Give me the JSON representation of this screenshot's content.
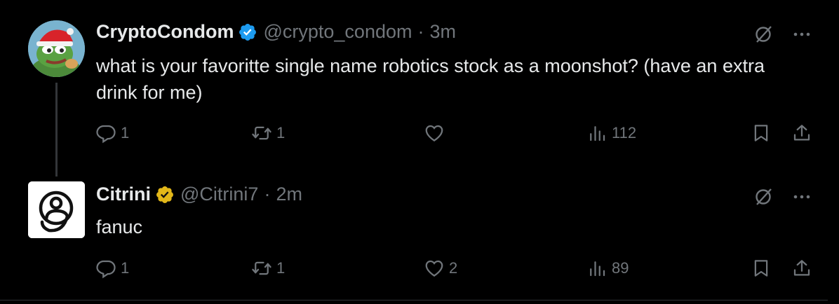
{
  "tweets": [
    {
      "display_name": "CryptoCondom",
      "handle": "@crypto_condom",
      "separator": "·",
      "time": "3m",
      "text": "what is your favoritte single name robotics stock as a moonshot? (have an extra drink for me)",
      "badge_color": "#1d9bf0",
      "replies": "1",
      "retweets": "1",
      "likes": "",
      "views": "112"
    },
    {
      "display_name": "Citrini",
      "handle": "@Citrini7",
      "separator": "·",
      "time": "2m",
      "text": "fanuc",
      "badge_color": "#e2b719",
      "replies": "1",
      "retweets": "1",
      "likes": "2",
      "views": "89"
    }
  ],
  "icons": {
    "reply": "reply-icon",
    "retweet": "retweet-icon",
    "like": "heart-icon",
    "views": "views-icon",
    "bookmark": "bookmark-icon",
    "share": "share-icon",
    "grok": "grok-icon",
    "more": "more-icon"
  },
  "colors": {
    "background": "#000000",
    "text": "#e7e9ea",
    "muted": "#71767b",
    "verified_blue": "#1d9bf0",
    "verified_gold": "#e2b719"
  }
}
